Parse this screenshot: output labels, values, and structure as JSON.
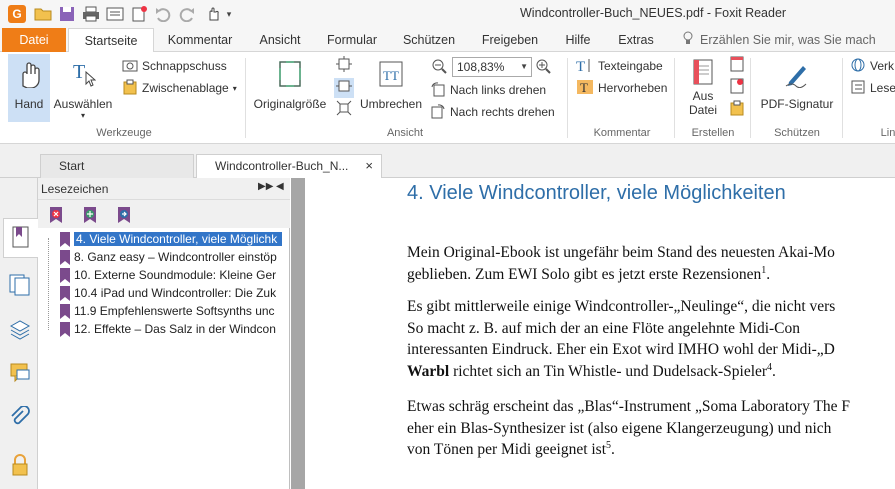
{
  "window": {
    "title": "Windcontroller-Buch_NEUES.pdf - Foxit Reader",
    "app_logo": "G"
  },
  "ribbon_tabs": [
    "Datei",
    "Startseite",
    "Kommentar",
    "Ansicht",
    "Formular",
    "Schützen",
    "Freigeben",
    "Hilfe",
    "Extras"
  ],
  "tell_me": "Erzählen Sie mir, was Sie mach",
  "ribbon": {
    "werkzeuge": {
      "hand": "Hand",
      "auswaehlen": "Auswählen",
      "schnappschuss": "Schnappschuss",
      "zwischenablage": "Zwischenablage",
      "label": "Werkzeuge"
    },
    "ansicht": {
      "originalgroesse": "Originalgröße",
      "umbrechen": "Umbrechen",
      "zoom": "108,83%",
      "links_drehen": "Nach links drehen",
      "rechts_drehen": "Nach rechts drehen",
      "label": "Ansicht"
    },
    "kommentar": {
      "texteingabe": "Texteingabe",
      "hervorheben": "Hervorheben",
      "label": "Kommentar"
    },
    "erstellen": {
      "aus_datei_1": "Aus",
      "aus_datei_2": "Datei",
      "label": "Erstellen"
    },
    "schuetzen": {
      "pdf_signatur": "PDF-Signatur",
      "label": "Schützen"
    },
    "cut_right": {
      "item1": "Verk",
      "item2": "Lese",
      "label": "Lin"
    }
  },
  "doc_tabs": [
    {
      "label": "Start"
    },
    {
      "label": "Windcontroller-Buch_N...",
      "close": "×"
    }
  ],
  "bookmarks": {
    "title": "Lesezeichen",
    "items": [
      "4. Viele Windcontroller, viele Möglichk",
      "8. Ganz easy – Windcontroller einstöp",
      "10. Externe Soundmodule: Kleine Ger",
      "10.4 iPad und Windcontroller: Die Zuk",
      "11.9 Empfehlenswerte Softsynths unc",
      "12. Effekte – Das Salz in der Windcon"
    ]
  },
  "document": {
    "heading": "4. Viele Windcontroller, viele Möglichkeiten",
    "p1_l1": "Mein Original-Ebook ist ungefähr beim Stand des neuesten Akai-Mo",
    "p1_l2": "geblieben. Zum EWI Solo gibt es jetzt erste Rezensionen",
    "p1_l2_sup": "1",
    "p1_l2_end": ".",
    "p2_l1": "Es gibt mittlerweile einige Windcontroller-„Neulinge“, die nicht vers",
    "p2_l2": "So macht z. B. auf mich der an eine Flöte angelehnte Midi-Con",
    "p2_l3": "interessanten Eindruck. Eher ein Exot wird IMHO wohl der Midi-„D",
    "p2_l4_bold": "Warbl",
    "p2_l4": " richtet sich an Tin Whistle- und Dudelsack-Spieler",
    "p2_l4_sup": "4",
    "p2_l4_end": ".",
    "p3_l1": "Etwas schräg erscheint das „Blas“-Instrument „Soma Laboratory The F",
    "p3_l2": "eher ein Blas-Synthesizer ist (also eigene Klangerzeugung) und nich",
    "p3_l3": "von Tönen per Midi geeignet ist",
    "p3_l3_sup": "5",
    "p3_l3_end": "."
  },
  "colors": {
    "accent": "#ef7d17",
    "selection": "#3275c8",
    "heading": "#2e6ea8",
    "bookmark_flag": "#7b4a8c"
  }
}
